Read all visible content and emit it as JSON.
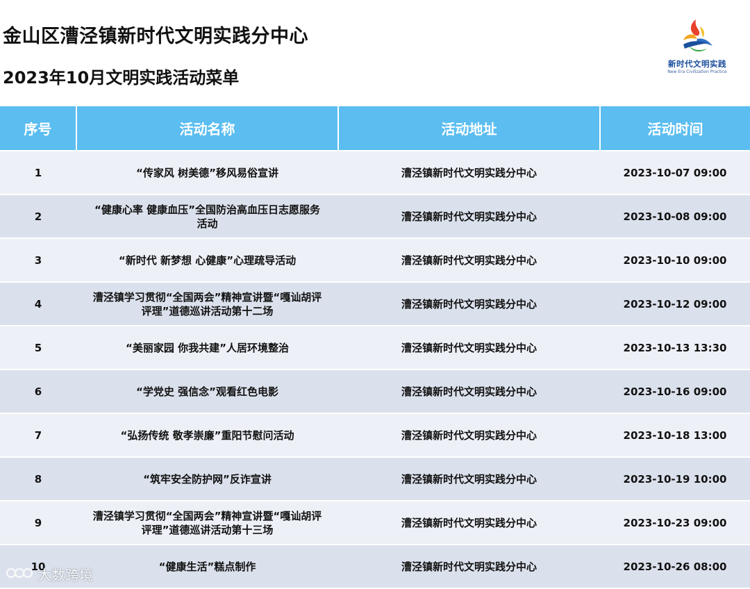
{
  "header": {
    "title": "金山区漕泾镇新时代文明实践分中心",
    "subtitle": "2023年10月文明实践活动菜单",
    "logo": {
      "name_cn": "新时代文明实践",
      "name_en": "New Era Civilization Practice"
    }
  },
  "table": {
    "columns": [
      "序号",
      "活动名称",
      "活动地址",
      "活动时间"
    ],
    "rows": [
      {
        "no": "1",
        "name": "“传家风 树美德”移风易俗宣讲",
        "address": "漕泾镇新时代文明实践分中心",
        "time": "2023-10-07 09:00"
      },
      {
        "no": "2",
        "name": "“健康心率 健康血压”全国防治高血压日志愿服务活动",
        "address": "漕泾镇新时代文明实践分中心",
        "time": "2023-10-08 09:00"
      },
      {
        "no": "3",
        "name": "“新时代 新梦想 心健康”心理疏导活动",
        "address": "漕泾镇新时代文明实践分中心",
        "time": "2023-10-10 09:00"
      },
      {
        "no": "4",
        "name": "漕泾镇学习贯彻“全国两会”精神宣讲暨“嘎讪胡评评理”道德巡讲活动第十二场",
        "address": "漕泾镇新时代文明实践分中心",
        "time": "2023-10-12 09:00"
      },
      {
        "no": "5",
        "name": "“美丽家园 你我共建”人居环境整治",
        "address": "漕泾镇新时代文明实践分中心",
        "time": "2023-10-13 13:30"
      },
      {
        "no": "6",
        "name": "“学党史 强信念”观看红色电影",
        "address": "漕泾镇新时代文明实践分中心",
        "time": "2023-10-16 09:00"
      },
      {
        "no": "7",
        "name": "“弘扬传统 敬孝崇廉”重阳节慰问活动",
        "address": "漕泾镇新时代文明实践分中心",
        "time": "2023-10-18 13:00"
      },
      {
        "no": "8",
        "name": "“筑牢安全防护网”反诈宣讲",
        "address": "漕泾镇新时代文明实践分中心",
        "time": "2023-10-19 10:00"
      },
      {
        "no": "9",
        "name": "漕泾镇学习贯彻“全国两会”精神宣讲暨“嘎讪胡评评理”道德巡讲活动第十三场",
        "address": "漕泾镇新时代文明实践分中心",
        "time": "2023-10-23 09:00"
      },
      {
        "no": "10",
        "name": "“健康生活”糕点制作",
        "address": "漕泾镇新时代文明实践分中心",
        "time": "2023-10-26 08:00"
      }
    ]
  },
  "watermark": {
    "text": "大数跨境"
  },
  "colors": {
    "header_bg": "#5bbdf0",
    "row_light": "#edf0f6",
    "row_dark": "#dbe1ec"
  }
}
